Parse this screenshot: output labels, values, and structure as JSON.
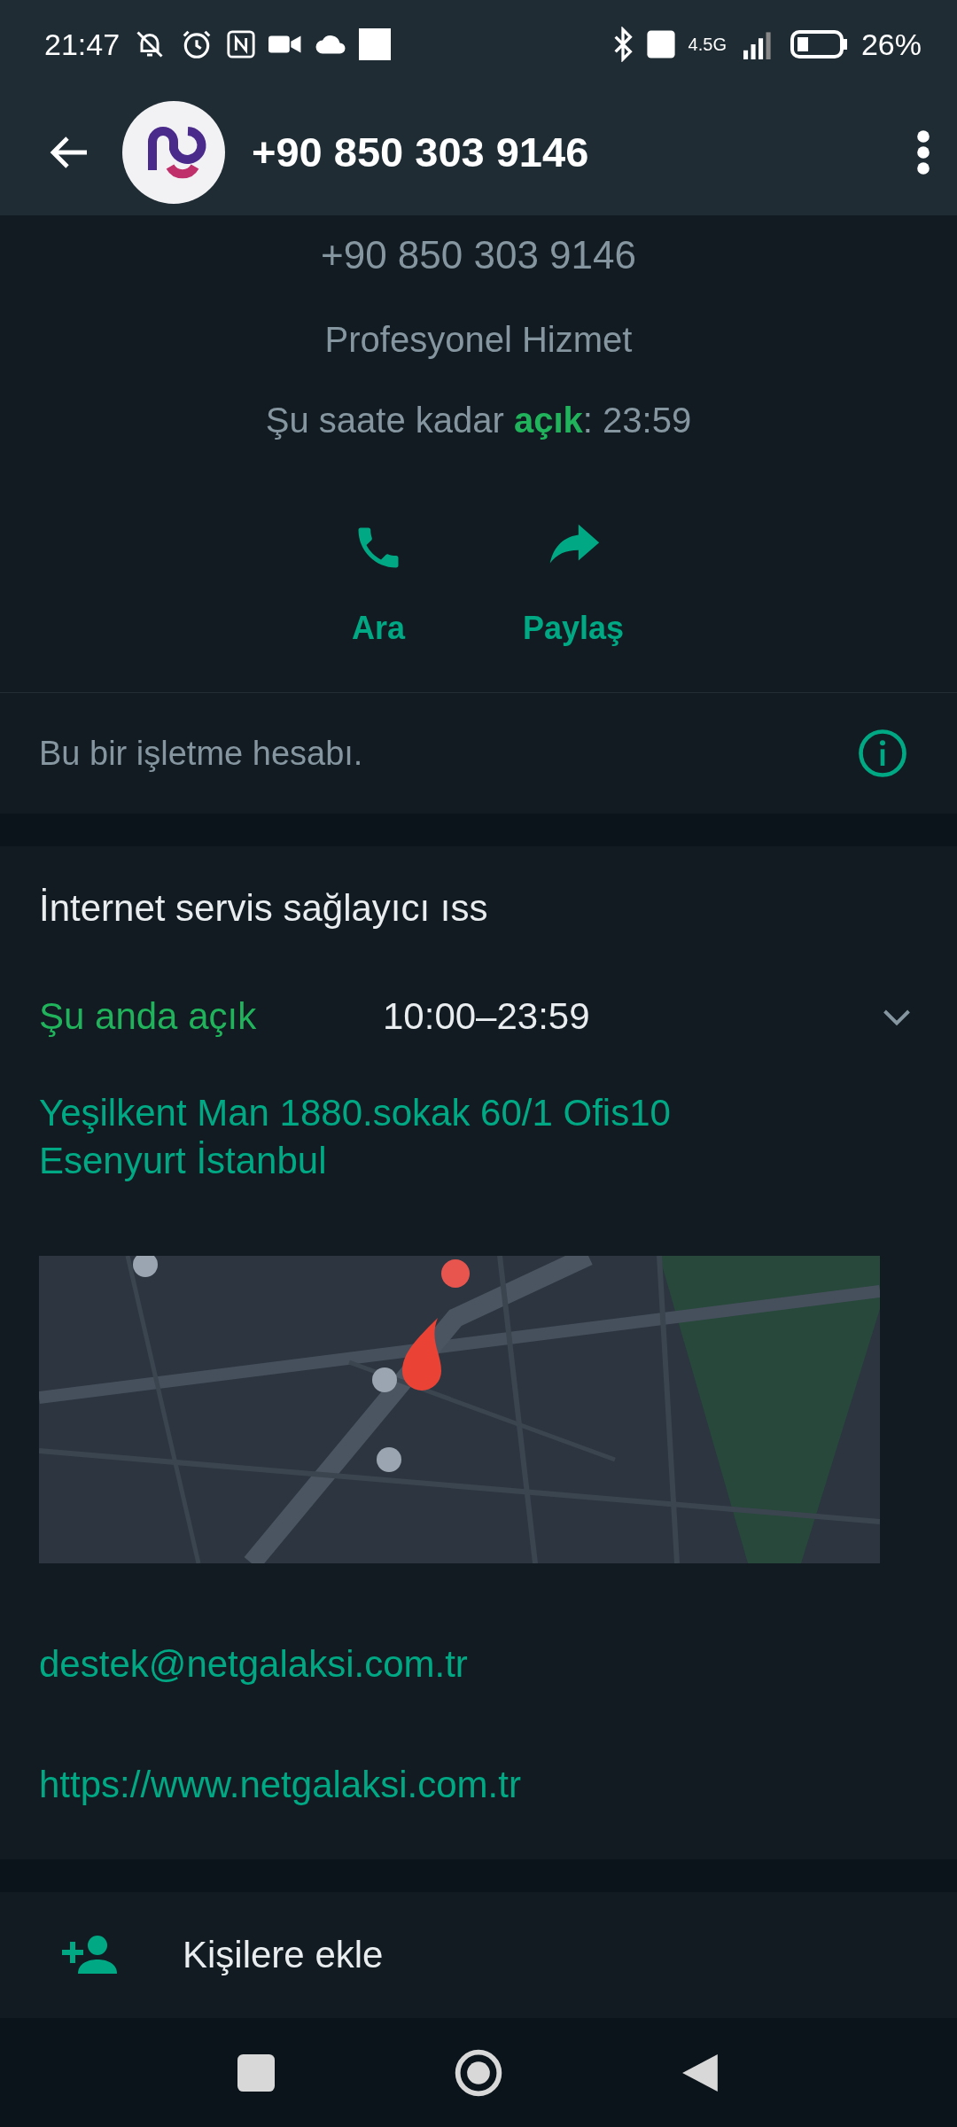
{
  "status_bar": {
    "time": "21:47",
    "network": "4.5G",
    "battery": "26%"
  },
  "header": {
    "title": "+90 850 303 9146"
  },
  "profile": {
    "phone": "+90 850 303 9146",
    "category": "Profesyonel Hizmet",
    "open_status": "Şu saate kadar **açık**: 23:59"
  },
  "actions": [
    {
      "kind": "call",
      "label": "Ara"
    },
    {
      "kind": "share",
      "label": "Paylaş"
    }
  ],
  "business_notice": "Bu bir işletme hesabı.",
  "business": {
    "description": "İnternet servis sağlayıcı ıss",
    "hours_status": "Şu anda açık",
    "hours": "10:00–23:59",
    "address": "Yeşilkent Man 1880.sokak 60/1 Ofis10 Esenyurt İstanbul",
    "email": "destek@netgalaksi.com.tr",
    "website": "https://www.netgalaksi.com.tr"
  },
  "add_contact": {
    "label": "Kişilere ekle"
  }
}
